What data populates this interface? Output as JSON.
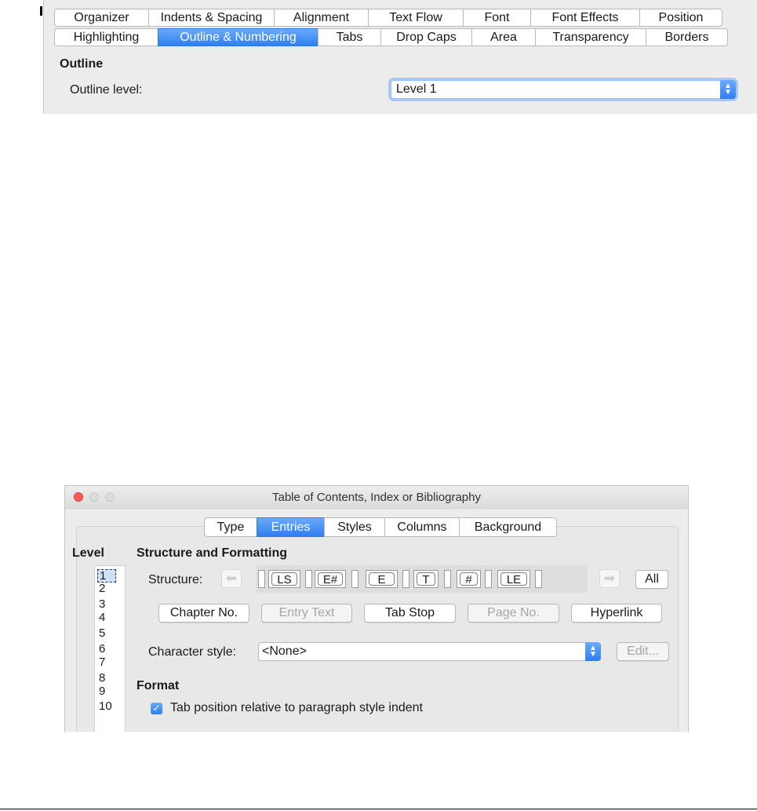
{
  "paragraph_dialog": {
    "tabs_row1": [
      "Organizer",
      "Indents & Spacing",
      "Alignment",
      "Text Flow",
      "Font",
      "Font Effects",
      "Position"
    ],
    "tabs_row2": [
      "Highlighting",
      "Outline & Numbering",
      "Tabs",
      "Drop Caps",
      "Area",
      "Transparency",
      "Borders"
    ],
    "active_tab": "Outline & Numbering",
    "section_title": "Outline",
    "outline_level_label": "Outline level:",
    "outline_level_value": "Level 1"
  },
  "toc_dialog": {
    "title": "Table of Contents, Index or Bibliography",
    "tabs": [
      "Type",
      "Entries",
      "Styles",
      "Columns",
      "Background"
    ],
    "active_tab": "Entries",
    "level_heading": "Level",
    "levels": [
      "1",
      "2",
      "3",
      "4",
      "5",
      "6",
      "7",
      "8",
      "9",
      "10"
    ],
    "selected_level": "1",
    "structure_heading": "Structure and Formatting",
    "structure_label": "Structure:",
    "tokens": [
      "LS",
      "E#",
      "E",
      "T",
      "#",
      "LE"
    ],
    "all_button": "All",
    "buttons": {
      "chapter_no": "Chapter No.",
      "entry_text": "Entry Text",
      "tab_stop": "Tab Stop",
      "page_no": "Page No.",
      "hyperlink": "Hyperlink"
    },
    "character_style_label": "Character style:",
    "character_style_value": "<None>",
    "edit_button": "Edit...",
    "format_heading": "Format",
    "tab_position_label": "Tab position relative to paragraph style indent",
    "tab_position_checked": true
  },
  "colors": {
    "accent": "#2f7ef0",
    "close_button": "#fc5b57"
  }
}
